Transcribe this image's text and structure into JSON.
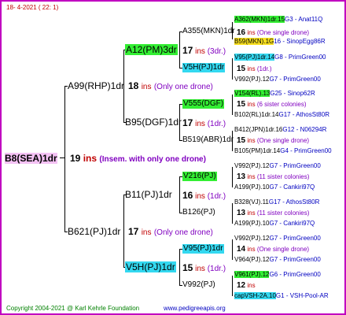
{
  "header": {
    "date": "18-  4-2021 (  22:  1)"
  },
  "root": {
    "code": "B8(SEA)1dr",
    "count": "19",
    "ins": "ins",
    "note": "(Insem. with only one drone)"
  },
  "gen1": [
    {
      "code": "A99(RHP)1dr",
      "count": "18",
      "ins": "ins",
      "note": "(Only one drone)"
    },
    {
      "code": "B621(PJ)1dr",
      "count": "17",
      "ins": "ins",
      "note": "(Only one drone)"
    }
  ],
  "gen2": [
    {
      "code": "A12(PM)3dr",
      "count": "17",
      "ins": "ins",
      "note": "(3dr.)"
    },
    {
      "code": "B95(DGF)1dr",
      "count": "17",
      "ins": "ins",
      "note": "(1dr.)"
    },
    {
      "code": "B11(PJ)1dr",
      "count": "16",
      "ins": "ins",
      "note": "(1dr.)"
    },
    {
      "code": "V5H(PJ)1dr",
      "count": "15",
      "ins": "ins",
      "note": "(1dr.)"
    }
  ],
  "gen3": [
    {
      "code": "A355(MKN)1dr",
      "count": "",
      "ins": "",
      "note": ""
    },
    {
      "code": "V5H(PJ)1dr",
      "count": "15",
      "ins": "ins",
      "note": "(1dr.)"
    },
    {
      "code": "V555(DGF)",
      "count": "15",
      "ins": "ins",
      "note": "(6 sister colonies)"
    },
    {
      "code": "B519(ABR)1dr",
      "count": "15",
      "ins": "ins",
      "note": "(One single drone)"
    },
    {
      "code": "V216(PJ)",
      "count": "13",
      "ins": "ins",
      "note": "(11 sister colonies)"
    },
    {
      "code": "B126(PJ)",
      "count": "13",
      "ins": "ins",
      "note": "(11 sister colonies)"
    },
    {
      "code": "V95(PJ)1dr",
      "count": "14",
      "ins": "ins",
      "note": "(One single drone)"
    },
    {
      "code": "V992(PJ)",
      "count": "12",
      "ins": "ins",
      "note": ""
    }
  ],
  "gen4": [
    {
      "code": "A362(MKN)1dr.15",
      "suffix": "G3 - Anat11Q"
    },
    {
      "code": "B59(MKN).1G",
      "suffix": "16 - SinopEgg86R"
    },
    {
      "code": "V95(PJ)1dr.14",
      "suffix": "G8 - PrimGreen00"
    },
    {
      "code": "V992(PJ).12",
      "suffix": "G7 - PrimGreen00"
    },
    {
      "code": "V154(RL).13",
      "suffix": "G25 - Sinop62R"
    },
    {
      "code": "B102(RL)1dr.14",
      "suffix": "G17 - AthosSt80R"
    },
    {
      "code": "B412(JPN)1dr.16",
      "suffix": "G12 - N06294R"
    },
    {
      "code": "B105(PM)1dr.14",
      "suffix": "G4 - PrimGreen00"
    },
    {
      "code": "V992(PJ).12",
      "suffix": "G7 - PrimGreen00"
    },
    {
      "code": "A199(PJ).10",
      "suffix": "G7 - Cankiri97Q"
    },
    {
      "code": "B328(VJ).11",
      "suffix": "G17 - AthosSt80R"
    },
    {
      "code": "A199(PJ).10",
      "suffix": "G7 - Cankiri97Q"
    },
    {
      "code": "V992(PJ).12",
      "suffix": "G7 - PrimGreen00"
    },
    {
      "code": "V964(PJ).12",
      "suffix": "G7 - PrimGreen00"
    },
    {
      "code": "V961(PJ).12",
      "suffix": "G6 - PrimGreen00"
    },
    {
      "code": "capVSH-2A.10",
      "suffix": "G1 - VSH-Pool-AR"
    }
  ],
  "footer": {
    "copyright": "Copyright 2004-2021 @ Karl Kehrle Foundation",
    "site": "www.pedigreeapis.org"
  }
}
